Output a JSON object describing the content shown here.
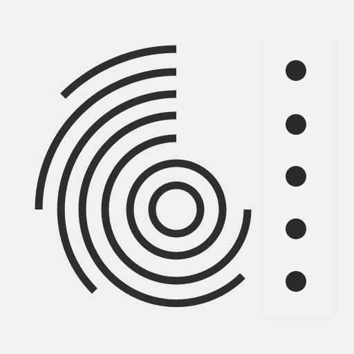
{
  "icon": {
    "symbol": "concentric-ripple-logo",
    "background_color": "#f0f0f0",
    "stroke_color": "#2e2e2e"
  },
  "menu": {
    "icon": "vertical-dots-icon",
    "dot_count": 5,
    "dot_color": "#2a2a2a"
  }
}
